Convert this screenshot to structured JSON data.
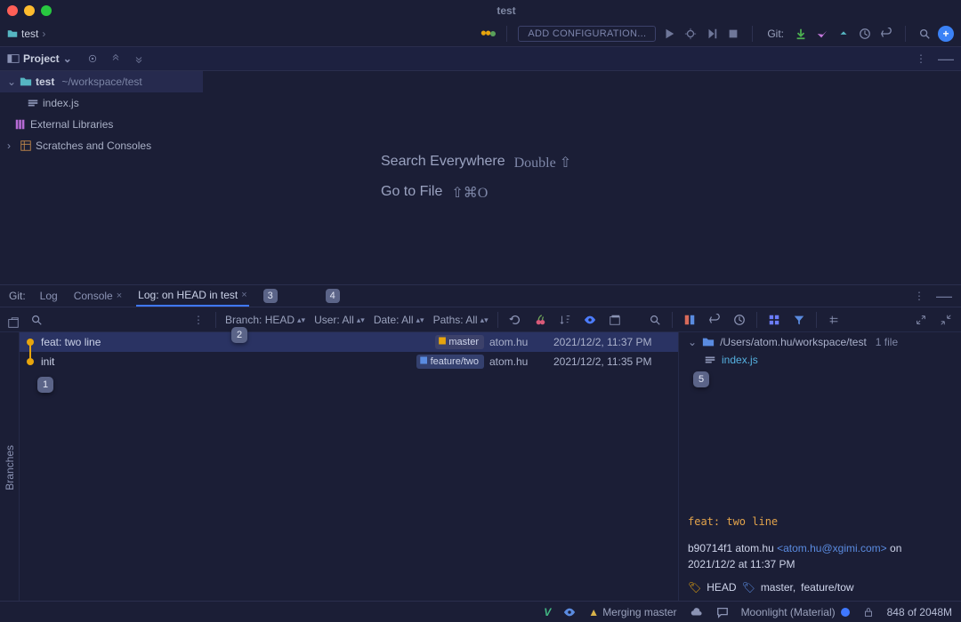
{
  "window": {
    "title": "test"
  },
  "breadcrumb": {
    "project": "test"
  },
  "run": {
    "add_config": "ADD CONFIGURATION..."
  },
  "git_label": "Git:",
  "tool": {
    "title": "Project"
  },
  "tree": {
    "root_name": "test",
    "root_path": "~/workspace/test",
    "file1": "index.js",
    "ext_lib": "External Libraries",
    "scratches": "Scratches and Consoles"
  },
  "hints": {
    "search_label": "Search Everywhere",
    "search_keys": "Double ⇧",
    "goto_label": "Go to File",
    "goto_keys": "⇧⌘O"
  },
  "tabs": {
    "git": "Git:",
    "log": "Log",
    "console": "Console",
    "head": "Log: on HEAD in test",
    "b3": "3",
    "b4": "4"
  },
  "filters": {
    "branch": "Branch: HEAD",
    "user": "User: All",
    "date": "Date: All",
    "paths": "Paths: All"
  },
  "commits": [
    {
      "msg": "feat: two line",
      "ref": "master",
      "author": "atom.hu",
      "date": "2021/12/2, 11:37 PM"
    },
    {
      "msg": "init",
      "ref": "feature/two",
      "author": "atom.hu",
      "date": "2021/12/2, 11:35 PM"
    }
  ],
  "b1": "1",
  "b2": "2",
  "b5": "5",
  "detail": {
    "path_root": "/Users/atom.hu/workspace/test",
    "file_count": "1 file",
    "file": "index.js",
    "subject": "feat: two line",
    "hash": "b90714f1",
    "author": "atom.hu",
    "email": "<atom.hu@xgimi.com>",
    "on": "on",
    "date": "2021/12/2 at 11:37 PM",
    "ref_head": "HEAD",
    "ref_master": "master,",
    "ref_feature": "feature/tow"
  },
  "status": {
    "merging": "Merging master",
    "theme": "Moonlight (Material)",
    "mem": "848 of 2048M"
  },
  "branches_strip": "Branches"
}
